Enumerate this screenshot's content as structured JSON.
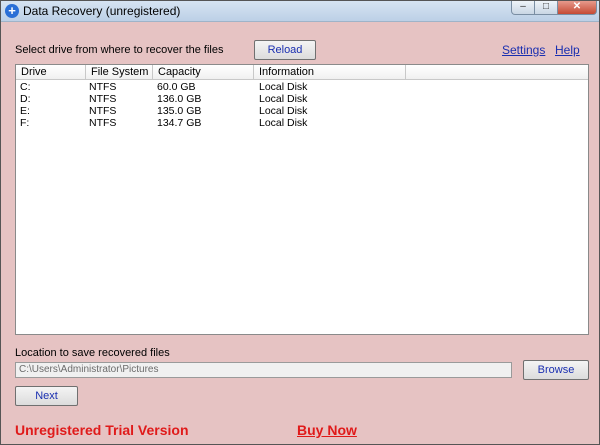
{
  "window": {
    "title": "Data Recovery (unregistered)"
  },
  "controls": {
    "minimize": "–",
    "maximize": "□",
    "close": "✕"
  },
  "top": {
    "instruction": "Select drive from where to recover the files",
    "reload_label": "Reload",
    "settings_label": "Settings",
    "help_label": "Help"
  },
  "table": {
    "columns": [
      "Drive",
      "File System",
      "Capacity",
      "Information"
    ],
    "rows": [
      [
        "C:",
        "NTFS",
        "60.0 GB",
        "Local Disk"
      ],
      [
        "D:",
        "NTFS",
        "136.0 GB",
        "Local Disk"
      ],
      [
        "E:",
        "NTFS",
        "135.0 GB",
        "Local Disk"
      ],
      [
        "F:",
        "NTFS",
        "134.7 GB",
        "Local Disk"
      ]
    ]
  },
  "save": {
    "label": "Location to save recovered files",
    "path": "C:\\Users\\Administrator\\Pictures",
    "browse_label": "Browse"
  },
  "next_label": "Next",
  "footer": {
    "trial_text": "Unregistered Trial Version",
    "buy_label": "Buy Now"
  }
}
